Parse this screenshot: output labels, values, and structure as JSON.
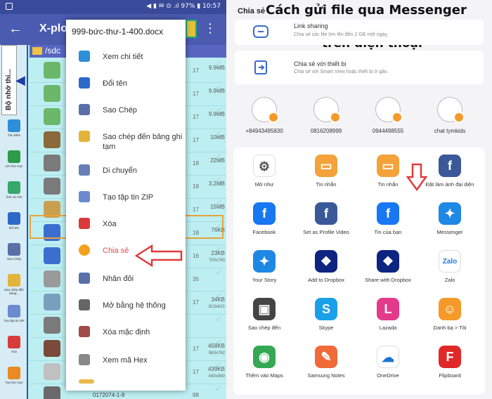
{
  "left_phone": {
    "status": {
      "right": "◀ ▮ ✉ ⊙ .ıl 97% ▮ 10:57"
    },
    "appbar": {
      "title": "X-plo",
      "more": "⋮",
      "back": "←"
    },
    "sidebar": {
      "tab_label": "Bộ nhớ thi...",
      "buttons": [
        {
          "label": "Tìm kiếm",
          "color": "#2c8fd8"
        },
        {
          "label": "Lên thư mục",
          "color": "#2c9b4a"
        },
        {
          "label": "Ảnh và Ảnh",
          "color": "#36a86a"
        },
        {
          "label": "Đổi tên",
          "color": "#2b69c8"
        },
        {
          "label": "Sao Chép",
          "color": "#5a6fa8"
        },
        {
          "label": "Sao chép đến bảng...",
          "color": "#e3b43a"
        },
        {
          "label": "Tạo tập tin ZIP",
          "color": "#6c8ad0"
        },
        {
          "label": "Xóa",
          "color": "#d93b3b"
        },
        {
          "label": "Tạo thư mục",
          "color": "#e98a24"
        }
      ]
    },
    "path": "/sdc",
    "files": [
      {
        "num": "17",
        "size": "9.9MB",
        "sub": ""
      },
      {
        "num": "17",
        "size": "9.9MB",
        "sub": ""
      },
      {
        "num": "17",
        "size": "9.9MB",
        "sub": ""
      },
      {
        "num": "17",
        "size": "10MB",
        "sub": ""
      },
      {
        "num": "18",
        "size": "22MB",
        "sub": ""
      },
      {
        "num": "18",
        "size": "3.2MB",
        "sub": ""
      },
      {
        "num": "17",
        "size": "15MB",
        "sub": ""
      },
      {
        "num": "18",
        "size": "76KB",
        "sub": ""
      },
      {
        "num": "16",
        "size": "23KB",
        "sub": "700x760"
      },
      {
        "num": "35",
        "size": "",
        "sub": ""
      },
      {
        "num": "17",
        "size": "34KB",
        "sub": "813x621"
      },
      {
        "num": "",
        "size": "",
        "sub": ""
      },
      {
        "num": "17",
        "size": "458KB",
        "sub": "963x762"
      },
      {
        "num": "17",
        "size": "439KB",
        "sub": "640x960"
      },
      {
        "num": "98",
        "size": "",
        "sub": ""
      }
    ],
    "bottom_text": "0172074-1-8",
    "menu": {
      "title": "999-bức-thư-1-400.docx",
      "items": [
        {
          "label": "Xem chi tiết",
          "icon": "info-icon",
          "color": "#2c8fd8"
        },
        {
          "label": "Đổi tên",
          "icon": "rename-icon",
          "color": "#2b69c8"
        },
        {
          "label": "Sao Chép",
          "icon": "copy-icon",
          "color": "#5a6fa8"
        },
        {
          "label": "Sao chép đến bảng ghi tạm",
          "icon": "clipboard-icon",
          "color": "#e3b43a"
        },
        {
          "label": "Di chuyển",
          "icon": "move-icon",
          "color": "#6a7fb8"
        },
        {
          "label": "Tạo tập tin ZIP",
          "icon": "zip-icon",
          "color": "#6c8ad0"
        },
        {
          "label": "Xóa",
          "icon": "trash-icon",
          "color": "#d93b3b"
        },
        {
          "label": "Chia sẻ",
          "icon": "share-icon",
          "color": "#f2a21f"
        },
        {
          "label": "Nhân đôi",
          "icon": "duplicate-icon",
          "color": "#5a6fa8"
        },
        {
          "label": "Mở bằng hệ thống",
          "icon": "gear-icon",
          "color": "#666666"
        },
        {
          "label": "Xóa mặc định",
          "icon": "gear-red-icon",
          "color": "#a14a4a"
        },
        {
          "label": "Xem mã Hex",
          "icon": "magnifier-icon",
          "color": "#888888"
        }
      ]
    }
  },
  "right_phone": {
    "share_label": "Chia sẻ",
    "headline_line1": "Cách gửi file qua Messenger",
    "headline_line2": "trên điện thoại",
    "options": [
      {
        "title": "Link sharing",
        "sub": "Chia sẻ các file lớn lên đến 2 GB một ngày.",
        "icon": "cloud-link-icon"
      },
      {
        "title": "Chia sẻ với thiết bị",
        "sub": "Chia sẻ với Smart View hoặc thiết bị ở gần.",
        "icon": "device-share-icon"
      }
    ],
    "contacts": [
      {
        "name": "+84943495830"
      },
      {
        "name": "0816208999"
      },
      {
        "name": "0944498555"
      },
      {
        "name": "chat tymkids"
      }
    ],
    "apps": [
      {
        "label": "Mở như",
        "color": "#ffffff",
        "glyph": "⚙",
        "fg": "#555555"
      },
      {
        "label": "Tin nhắn",
        "color": "#f4a23a",
        "glyph": "▭",
        "fg": "#ffffff"
      },
      {
        "label": "Tin nhắn",
        "color": "#f4a23a",
        "glyph": "▭",
        "fg": "#ffffff"
      },
      {
        "label": "Đặt làm ảnh đại diện",
        "color": "#3b5998",
        "glyph": "f",
        "fg": "#ffffff"
      },
      {
        "label": "Facebook",
        "color": "#1877f2",
        "glyph": "f",
        "fg": "#ffffff"
      },
      {
        "label": "Set as Profile Video",
        "color": "#3b5998",
        "glyph": "f",
        "fg": "#ffffff"
      },
      {
        "label": "Tin của bạn",
        "color": "#1877f2",
        "glyph": "f",
        "fg": "#ffffff"
      },
      {
        "label": "Messenger",
        "color": "#1e88e5",
        "glyph": "✦",
        "fg": "#ffffff"
      },
      {
        "label": "Your Story",
        "color": "#1e88e5",
        "glyph": "✦",
        "fg": "#ffffff"
      },
      {
        "label": "Add to Dropbox",
        "color": "#0d2481",
        "glyph": "❖",
        "fg": "#ffffff"
      },
      {
        "label": "Share with Dropbox",
        "color": "#0d2481",
        "glyph": "❖",
        "fg": "#ffffff"
      },
      {
        "label": "Zalo",
        "color": "#ffffff",
        "glyph": "Zalo",
        "fg": "#1e7ce0"
      },
      {
        "label": "Sao chép đến",
        "color": "#444444",
        "glyph": "▣",
        "fg": "#ffffff"
      },
      {
        "label": "Skype",
        "color": "#1aa0e8",
        "glyph": "S",
        "fg": "#ffffff"
      },
      {
        "label": "Lazada",
        "color": "#e43a8a",
        "glyph": "L",
        "fg": "#ffffff"
      },
      {
        "label": "Danh bạ > Tôi",
        "color": "#f59a2a",
        "glyph": "☺",
        "fg": "#ffffff"
      },
      {
        "label": "Thêm vào Maps",
        "color": "#34a853",
        "glyph": "◉",
        "fg": "#ffffff"
      },
      {
        "label": "Samsung Notes",
        "color": "#f06a3a",
        "glyph": "✎",
        "fg": "#ffffff"
      },
      {
        "label": "OneDrive",
        "color": "#ffffff",
        "glyph": "☁",
        "fg": "#1a73d0"
      },
      {
        "label": "Flipboard",
        "color": "#e12828",
        "glyph": "F",
        "fg": "#ffffff"
      }
    ],
    "highlight_color": "#e23b3b"
  }
}
